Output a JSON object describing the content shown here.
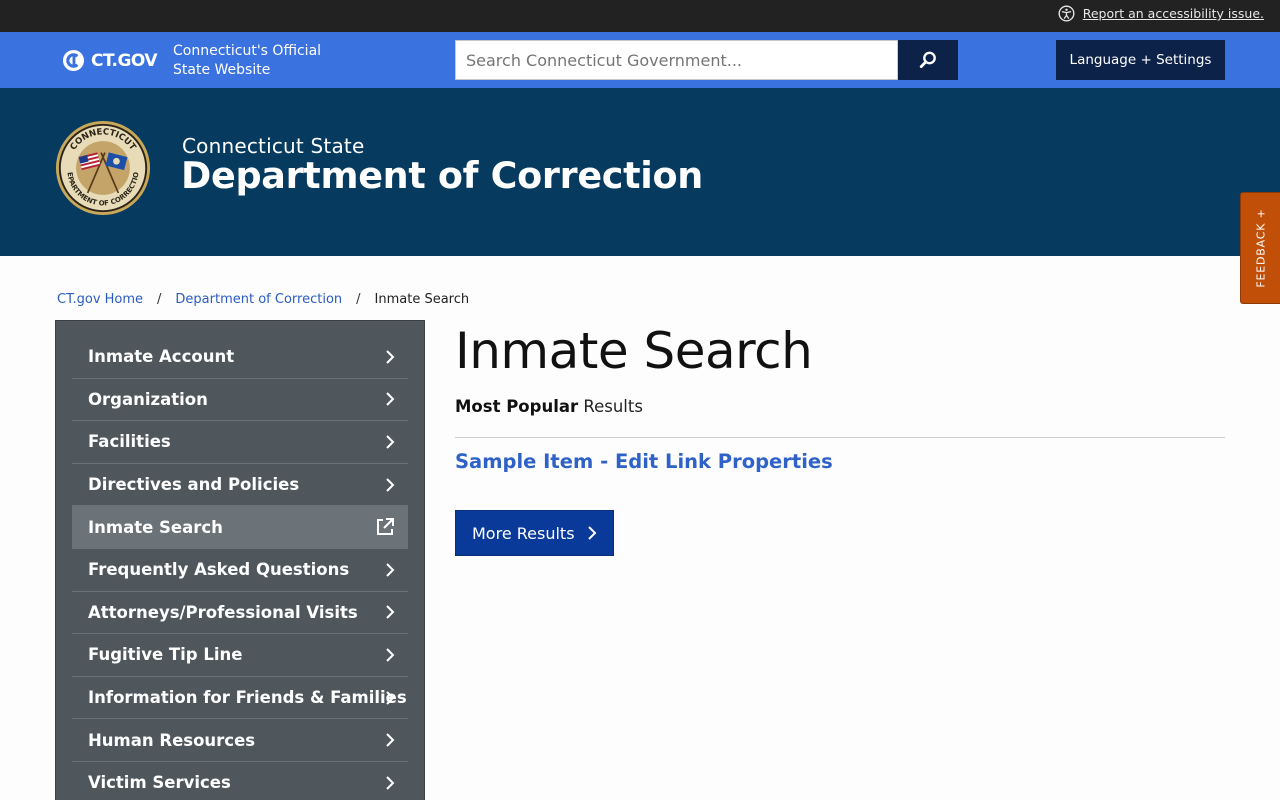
{
  "utility_bar": {
    "accessibility_link": "Report an accessibility issue."
  },
  "ctgov_bar": {
    "logo_text": "CT.GOV",
    "tagline": "Connecticut's Official State Website",
    "search_placeholder": "Search Connecticut Government...",
    "language_button": "Language + Settings"
  },
  "agency": {
    "kicker": "Connecticut State",
    "title": "Department of Correction",
    "seal_text": "CONNECTICUT DEPARTMENT OF CORRECTION"
  },
  "feedback": {
    "label": "FEEDBACK +"
  },
  "breadcrumb": {
    "items": [
      "CT.gov Home",
      "Department of Correction"
    ],
    "current": "Inmate Search",
    "separator": "/"
  },
  "sidebar": {
    "items": [
      {
        "label": "Inmate Account",
        "icon": "chevron-right-icon"
      },
      {
        "label": "Organization",
        "icon": "chevron-right-icon"
      },
      {
        "label": "Facilities",
        "icon": "chevron-right-icon"
      },
      {
        "label": "Directives and Policies",
        "icon": "chevron-right-icon"
      },
      {
        "label": "Inmate Search",
        "icon": "external-link-icon",
        "active": true
      },
      {
        "label": "Frequently Asked Questions",
        "icon": "chevron-right-icon"
      },
      {
        "label": "Attorneys/Professional Visits",
        "icon": "chevron-right-icon"
      },
      {
        "label": "Fugitive Tip Line",
        "icon": "chevron-right-icon"
      },
      {
        "label": "Information for Friends & Families",
        "icon": "chevron-right-icon"
      },
      {
        "label": "Human Resources",
        "icon": "chevron-right-icon"
      },
      {
        "label": "Victim Services",
        "icon": "chevron-right-icon"
      }
    ]
  },
  "main": {
    "title": "Inmate Search",
    "popular_bold": "Most Popular",
    "popular_rest": " Results",
    "result_link": "Sample Item - Edit Link Properties",
    "more_button": "More Results"
  },
  "colors": {
    "utility_bar": "#222222",
    "ctgov_bar": "#3a72e0",
    "navy": "#0c2249",
    "agency_banner": "#063a5e",
    "sidebar": "#4f575d",
    "feedback": "#c24f08",
    "link": "#2f62c8",
    "button": "#0a3a99"
  }
}
